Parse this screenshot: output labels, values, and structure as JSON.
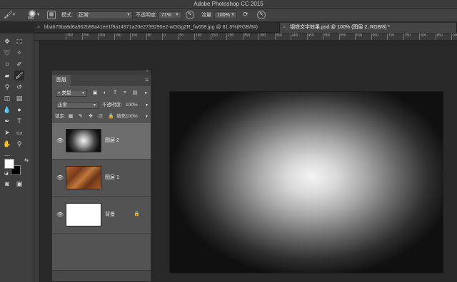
{
  "app": {
    "title": "Adobe Photoshop CC 2015"
  },
  "options_bar": {
    "brush_size": "900",
    "mode_label": "模式:",
    "mode_value": "正常",
    "opacity_label": "不透明度:",
    "opacity_value": "71%",
    "flow_label": "流量:",
    "flow_value": "100%"
  },
  "tabs": [
    {
      "label": "bba675ba8d6a962b88a41ee1f9a14971a20e2739290e2-wOGgZR_fw658.jpg @ 81.5%(RGB/8#)",
      "active": false
    },
    {
      "label": "钢铁文字效果.psd @ 100% (图层 2, RGB/8) *",
      "active": true
    }
  ],
  "ruler": {
    "ticks": [
      "300",
      "250",
      "200",
      "150",
      "100",
      "50",
      "0",
      "50",
      "100",
      "150",
      "200",
      "250",
      "300",
      "350",
      "400",
      "450",
      "500",
      "550",
      "600",
      "650",
      "700",
      "750",
      "800",
      "850",
      "900",
      "950"
    ]
  },
  "layers_panel": {
    "tab_label": "图层",
    "filter_kind": "类型",
    "blend_mode": "正常",
    "opacity_label": "不透明度:",
    "opacity_value": "100%",
    "lock_label": "锁定:",
    "fill_label": "填充:",
    "fill_value": "100%",
    "layers": [
      {
        "name": "图层 2",
        "selected": true,
        "visible": true,
        "thumb": "glow",
        "locked": false
      },
      {
        "name": "图层 1",
        "selected": false,
        "visible": true,
        "thumb": "rust",
        "locked": false
      },
      {
        "name": "背景",
        "selected": false,
        "visible": true,
        "thumb": "white",
        "locked": true
      }
    ]
  },
  "colors": {
    "foreground": "#ffffff",
    "background": "#000000",
    "accent_selected_layer": "#6d6d6d"
  }
}
